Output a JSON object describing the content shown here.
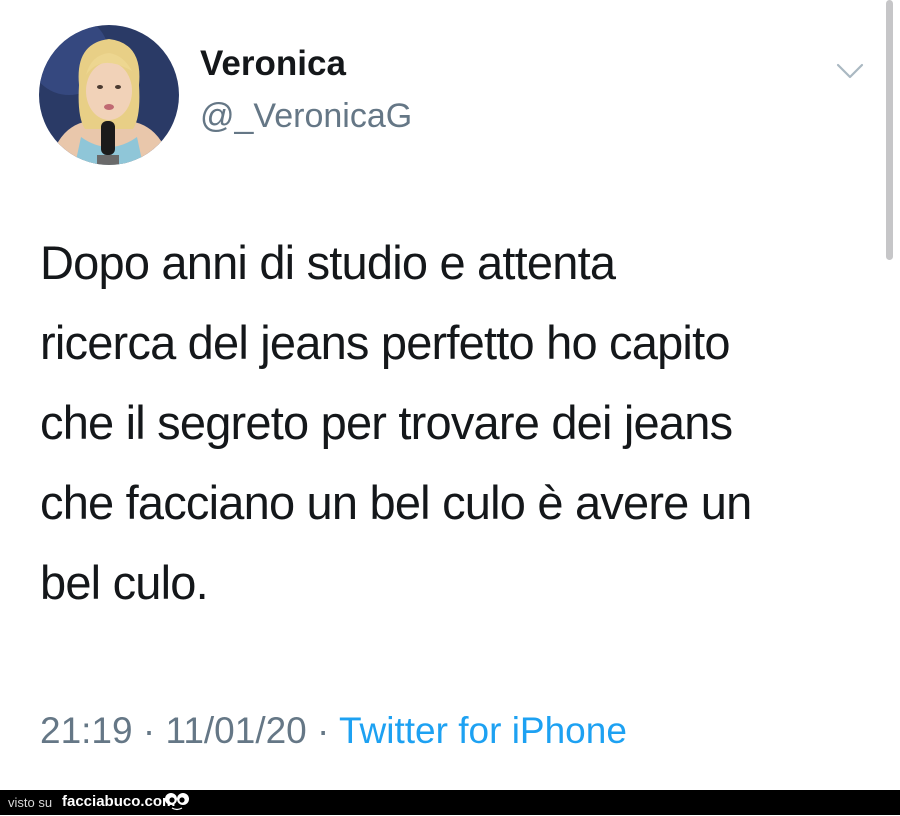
{
  "tweet": {
    "user": {
      "display_name": "Veronica",
      "handle": "@_VeronicaG"
    },
    "text_lines": [
      "Dopo anni di studio e attenta",
      "ricerca del jeans perfetto ho capito",
      "che il segreto per trovare dei jeans",
      "che facciano un bel culo è avere un",
      "bel culo."
    ],
    "time": "21:19",
    "separator": "·",
    "date": "11/01/20",
    "source": "Twitter for iPhone"
  },
  "footer": {
    "visto_su": "visto su",
    "site": "facciabuco.com"
  },
  "colors": {
    "text": "#14171a",
    "secondary": "#657786",
    "link": "#1da1f2",
    "footer_bg": "#000000"
  },
  "icons": {
    "caret": "chevron-down-icon",
    "avatar": "profile-photo",
    "logo": "facciabuco-eyes-logo"
  }
}
